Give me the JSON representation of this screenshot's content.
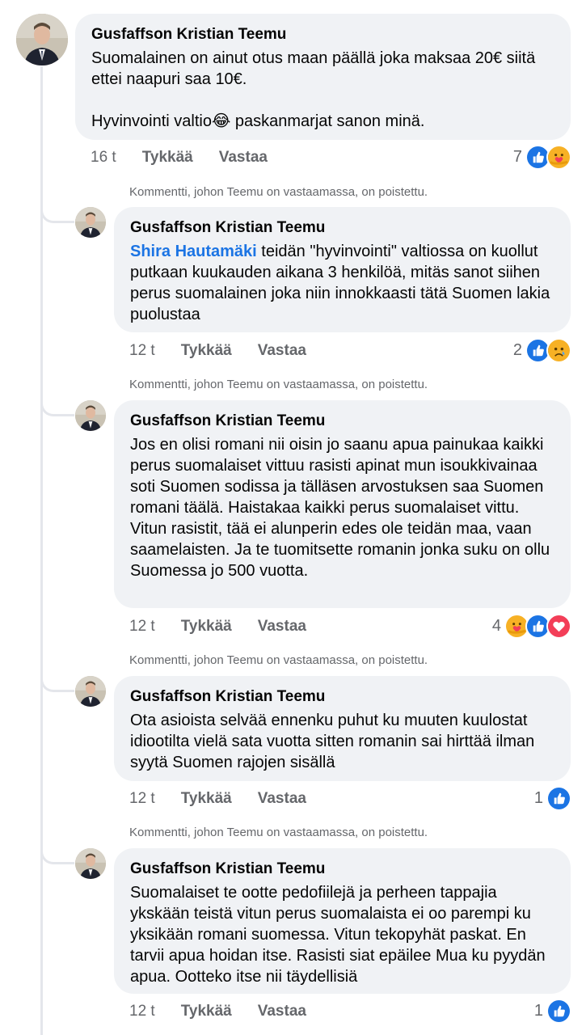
{
  "comments": [
    {
      "author": "Gusfaffson Kristian Teemu",
      "text": "Suomalainen on ainut otus maan päällä joka maksaa 20€ siitä ettei naapuri saa 10€.\n\nHyvinvointi valtio",
      "emoji": "😂",
      "text_after": " paskanmarjat sanon minä.",
      "time": "16 t",
      "like": "Tykkää",
      "reply": "Vastaa",
      "reaction_count": "7",
      "reactions": [
        "like-icon",
        "care-icon"
      ]
    },
    {
      "deleted_note": "Kommentti, johon Teemu on vastaamassa, on poistettu.",
      "author": "Gusfaffson Kristian Teemu",
      "mention": "Shira Hautamäki",
      "text": " teidän \"hyvinvointi\" valtiossa on kuollut putkaan kuukauden aikana 3 henkilöä, mitäs sanot siihen perus suomalainen joka niin innokkaasti tätä Suomen lakia puolustaa",
      "time": "12 t",
      "like": "Tykkää",
      "reply": "Vastaa",
      "reaction_count": "2",
      "reactions": [
        "like-icon",
        "sad-icon"
      ]
    },
    {
      "deleted_note": "Kommentti, johon Teemu on vastaamassa, on poistettu.",
      "author": "Gusfaffson Kristian Teemu",
      "text": "Jos en olisi romani nii oisin jo saanu apua painukaa kaikki perus suomalaiset vittuu rasisti apinat mun isoukkivainaa soti Suomen sodissa ja tälläsen arvostuksen saa Suomen romani täälä. Haistakaa kaikki perus suomalaiset vittu. Vitun rasistit, tää ei alunperin edes ole teidän maa, vaan saamelaisten. Ja te tuomitsette romanin jonka suku on ollu Suomessa jo 500 vuotta.",
      "time": "12 t",
      "like": "Tykkää",
      "reply": "Vastaa",
      "reaction_count": "4",
      "reactions": [
        "care-icon",
        "like-icon",
        "love-icon"
      ]
    },
    {
      "deleted_note": "Kommentti, johon Teemu on vastaamassa, on poistettu.",
      "author": "Gusfaffson Kristian Teemu",
      "text": "Ota asioista selvää ennenku puhut ku muuten kuulostat idiootilta vielä sata vuotta sitten romanin sai hirttää ilman syytä Suomen rajojen sisällä",
      "time": "12 t",
      "like": "Tykkää",
      "reply": "Vastaa",
      "reaction_count": "1",
      "reactions": [
        "like-icon"
      ]
    },
    {
      "deleted_note": "Kommentti, johon Teemu on vastaamassa, on poistettu.",
      "author": "Gusfaffson Kristian Teemu",
      "text": "Suomalaiset te ootte pedofiilejä ja perheen tappajia ykskään teistä vitun perus suomalaista ei oo parempi ku yksikään romani suomessa. Vitun tekopyhät paskat. En tarvii apua hoidan itse. Rasisti siat epäilee Mua ku pyydän apua. Ootteko itse nii täydellisiä",
      "time": "12 t",
      "like": "Tykkää",
      "reply": "Vastaa",
      "reaction_count": "1",
      "reactions": [
        "like-icon"
      ]
    }
  ],
  "colors": {
    "bubble": "#f0f2f5",
    "mention": "#1b74e4",
    "meta": "#65676b",
    "like_blue": "#1b74e4",
    "love_red": "#f33e58",
    "emoji_yellow": "#f7b125"
  }
}
